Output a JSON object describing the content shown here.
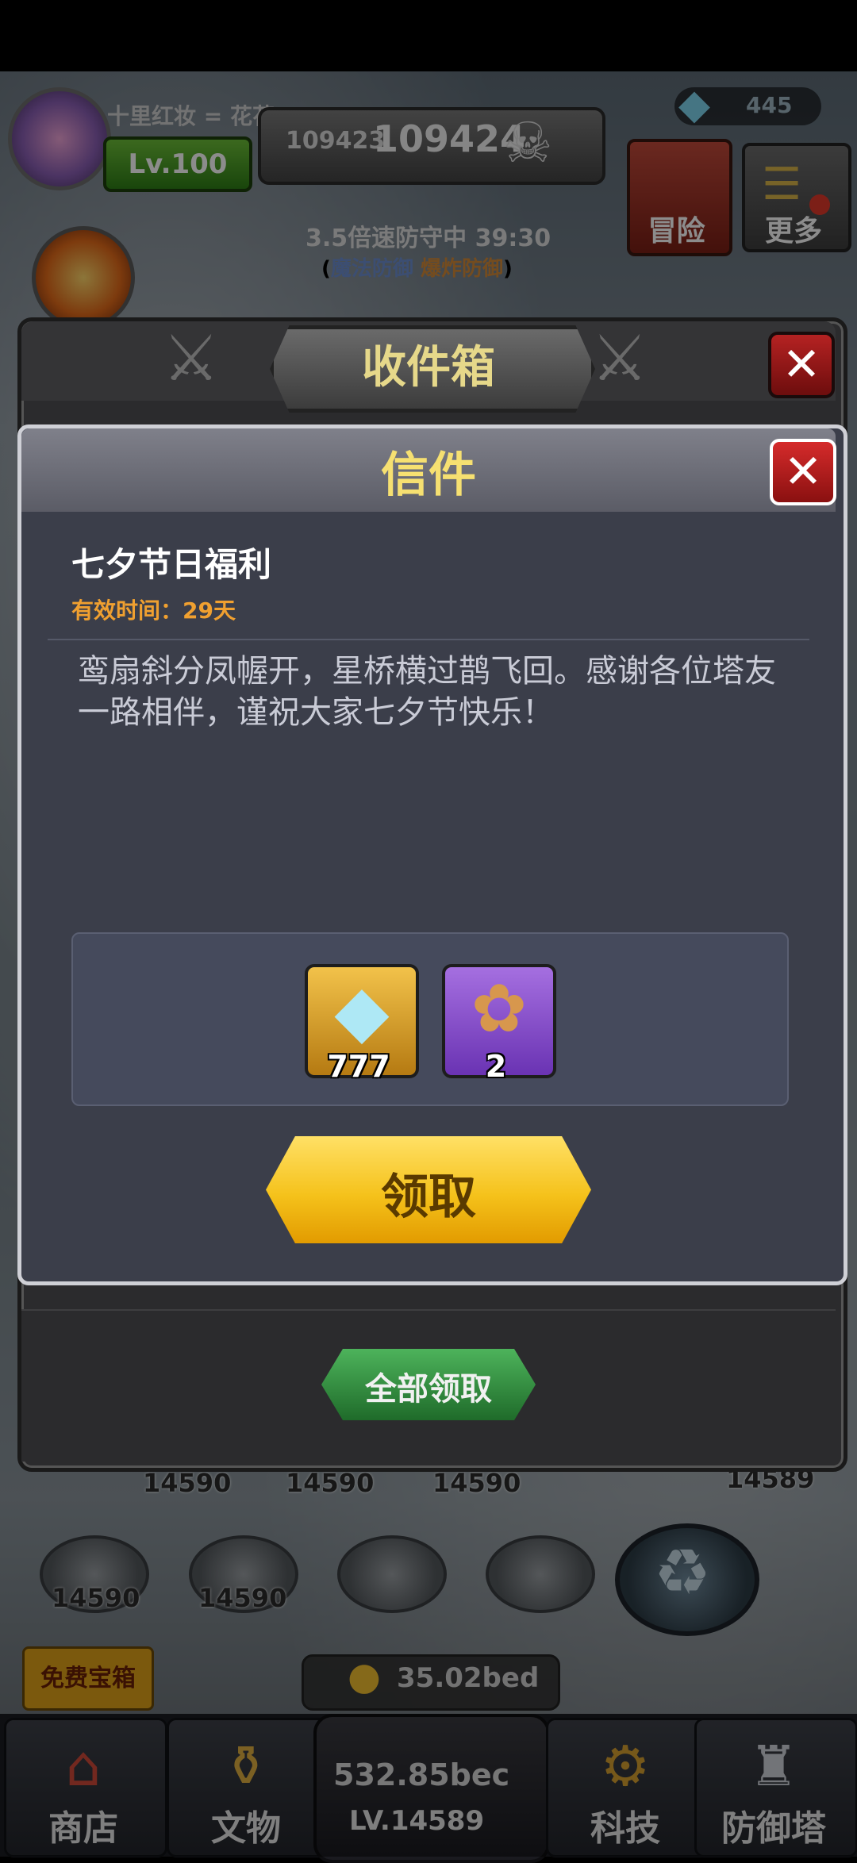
{
  "hud": {
    "player_name": "十里红妆 = 花花",
    "level": "Lv.100",
    "score_left": "109423",
    "score_right": "109424",
    "gems": "445",
    "adventure": "冒险",
    "more": "更多",
    "boost_text": "3.5倍速防守中 39:30",
    "tag_magic": "魔法防御",
    "tag_bomb": "爆炸防御"
  },
  "inbox": {
    "title": "收件箱",
    "claim_all": "全部领取"
  },
  "letter": {
    "title": "信件",
    "subject": "七夕节日福利",
    "valid_label": "有效时间：",
    "valid_value": "29天",
    "body": "鸾扇斜分凤幄开，星桥横过鹊飞回。感谢各位塔友一路相伴，谨祝大家七夕节快乐！",
    "rewards": [
      {
        "icon": "diamond-icon",
        "qty": "777"
      },
      {
        "icon": "bag-icon",
        "qty": "2"
      }
    ],
    "claim": "领取"
  },
  "board": {
    "top_nums": [
      "14590",
      "14590",
      "14590",
      "14589"
    ],
    "mid_nums": [
      "14590",
      "14590"
    ]
  },
  "bottom": {
    "free_chest": "免费宝箱",
    "gold_small": "35.02bed",
    "center_gold": "532.85bec",
    "center_level": "LV.14589",
    "nav": [
      "商店",
      "文物",
      "科技",
      "防御塔"
    ]
  },
  "colors": {
    "claim_yellow": "#f5c21b",
    "close_red": "#d52b2b",
    "title_gold": "#f6e071",
    "valid_orange": "#f0a030"
  }
}
